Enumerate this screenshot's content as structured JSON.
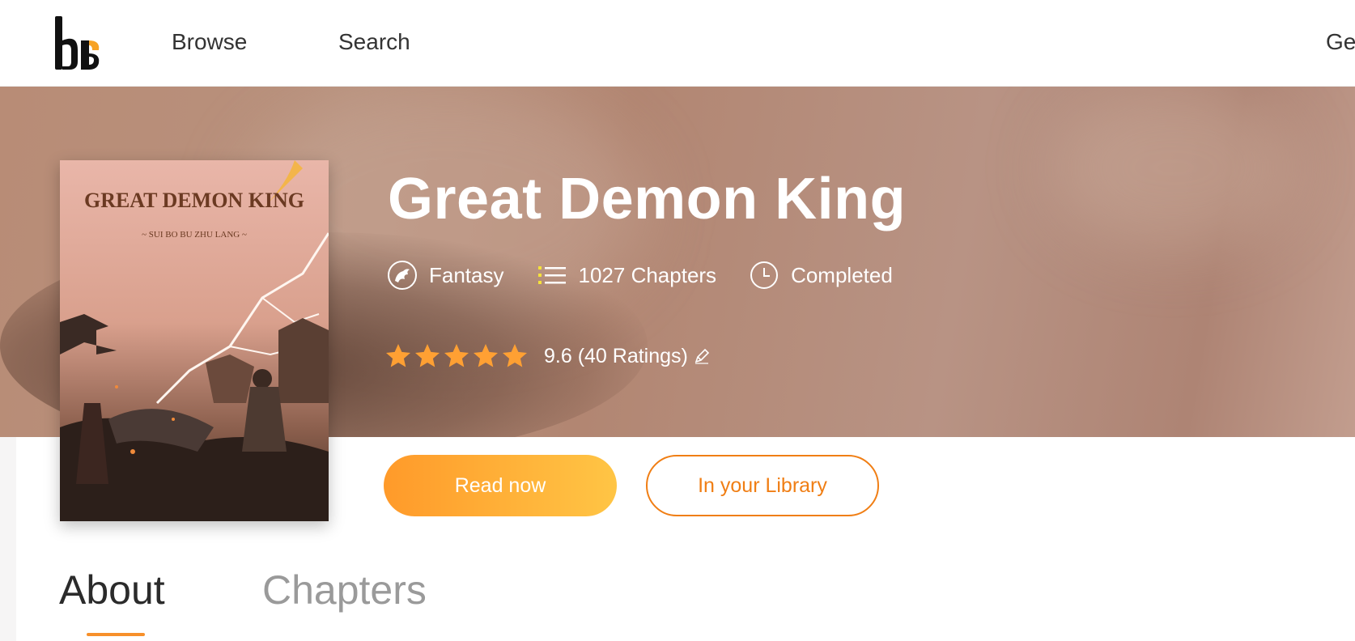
{
  "nav": {
    "logo_text": "bg",
    "browse_label": "Browse",
    "search_label": "Search",
    "right_label": "Ge"
  },
  "book": {
    "cover_title": "GREAT DEMON KING",
    "cover_author": "~ SUI BO BU ZHU LANG ~",
    "title": "Great Demon King",
    "genre": "Fantasy",
    "chapters": "1027 Chapters",
    "status": "Completed",
    "rating_stars": 5,
    "rating_text": "9.6 (40 Ratings)"
  },
  "actions": {
    "read_label": "Read now",
    "library_label": "In your Library"
  },
  "tabs": [
    {
      "label": "About",
      "active": true
    },
    {
      "label": "Chapters",
      "active": false
    }
  ],
  "icons": {
    "genre": "dragon-icon",
    "chapters": "list-icon",
    "status": "clock-icon",
    "rating": "star-icon",
    "edit": "pencil-icon"
  },
  "colors": {
    "accent": "#f7902a",
    "button_gradient_start": "#ff9a2a",
    "button_gradient_end": "#ffc545",
    "library_border": "#f07e14",
    "star": "#ffa033"
  }
}
